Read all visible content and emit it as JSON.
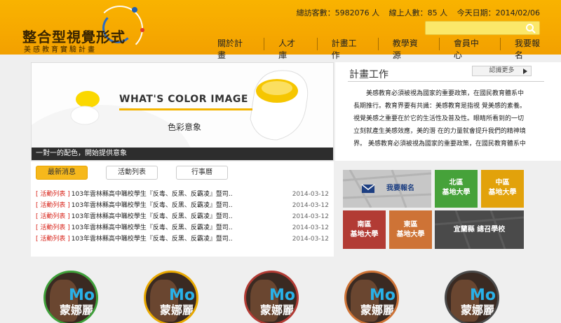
{
  "header": {
    "logo_title": "整合型視覺形式",
    "logo_sub": "美感教育實驗計畫",
    "stats": {
      "visits": "總訪客數：5982076 人",
      "online": "線上人數：85 人",
      "date": "今天日期：2014/02/06"
    },
    "search_placeholder": ""
  },
  "nav": {
    "items": [
      "關於計畫",
      "人才庫",
      "計畫工作",
      "教學資源",
      "會員中心",
      "我要報名"
    ]
  },
  "banner": {
    "title": "WHAT'S COLOR IMAGE",
    "subtitle": "色彩意象",
    "caption": "一對一的配色，開始提供意象"
  },
  "plan": {
    "title": "計畫工作",
    "more": "認識更多",
    "text": "美感教育必須被視為國家的重要政策，在國民教育體系中長期推行。教育界要有共識：美感教育是指視 覺美感的素養。視覺美感之重要在於它的生活性及普及性。眼睛所看到的一切立刻就產生美感效應，美的潛 在的力量就會提升我們的精神境界。 美感教育必須被視為國家的重要政策，在國民教育體系中"
  },
  "news": {
    "tabs": [
      "最新消息",
      "活動列表",
      "行事曆"
    ],
    "rows": [
      {
        "cat": "[ 活動列表 ]",
        "text": "103年雲林縣高中職校學生『反毒、反黑、反霸凌』暨司..",
        "date": "2014-03-12"
      },
      {
        "cat": "[ 活動列表 ]",
        "text": "103年雲林縣高中職校學生『反毒、反黑、反霸凌』暨司..",
        "date": "2014-03-12"
      },
      {
        "cat": "[ 活動列表 ]",
        "text": "103年雲林縣高中職校學生『反毒、反黑、反霸凌』暨司..",
        "date": "2014-03-12"
      },
      {
        "cat": "[ 活動列表 ]",
        "text": "103年雲林縣高中職校學生『反毒、反黑、反霸凌』暨司..",
        "date": "2014-03-12"
      },
      {
        "cat": "[ 活動列表 ]",
        "text": "103年雲林縣高中職校學生『反毒、反黑、反霸凌』暨司..",
        "date": "2014-03-12"
      }
    ]
  },
  "tiles": {
    "apply": "我要報名",
    "north": [
      "北區",
      "基地大學"
    ],
    "center": [
      "中區",
      "基地大學"
    ],
    "south": [
      "南區",
      "基地大學"
    ],
    "east": [
      "東區",
      "基地大學"
    ],
    "yilan": "宜蘭縣 總召學校"
  },
  "gallery": {
    "label": "蒙娜麗",
    "overlay": "Mo"
  },
  "colors": {
    "header": "#f6a800",
    "accent": "#f4b400",
    "news_cat": "#d8251b"
  }
}
